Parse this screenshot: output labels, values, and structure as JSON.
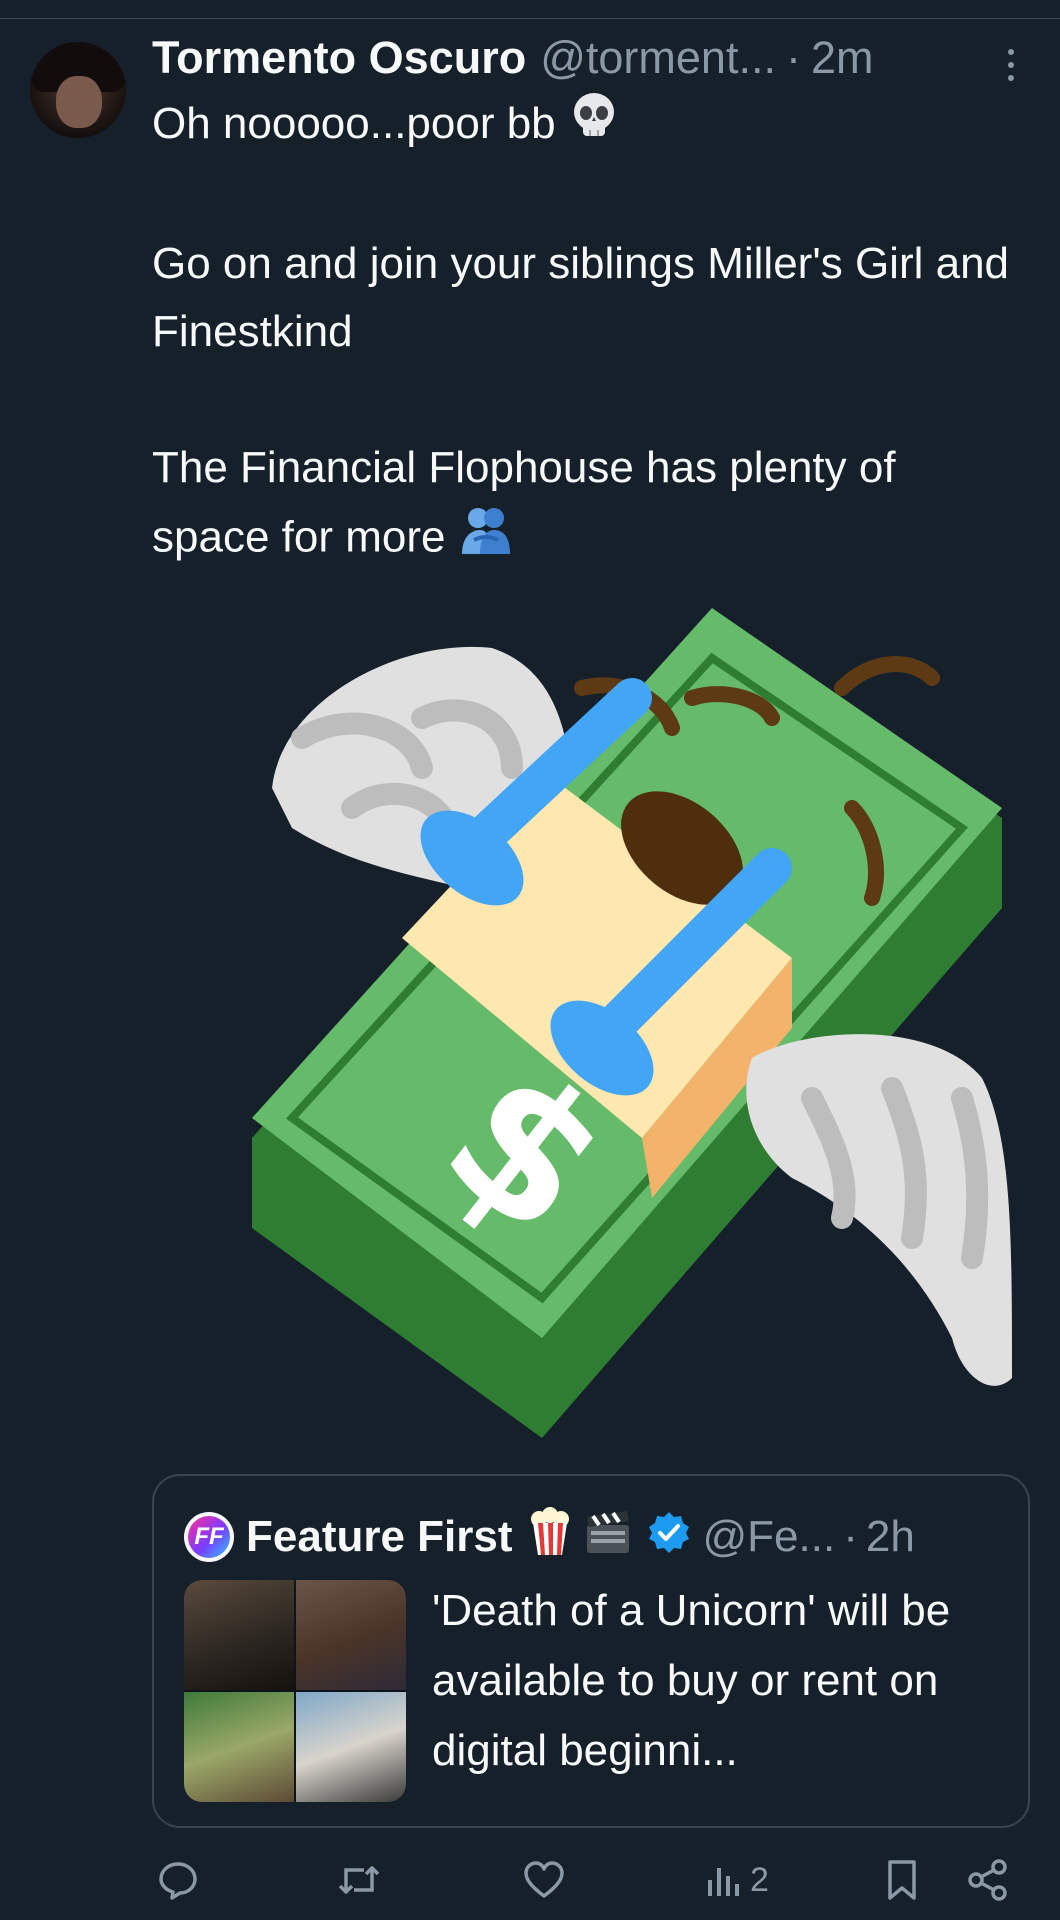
{
  "tweet": {
    "author_name": "Tormento Oscuro",
    "author_handle": "@torment...",
    "separator": "·",
    "time": "2m",
    "lines": [
      "Oh nooooo...poor bb",
      "Go on and join your siblings Miller's Girl and Finestkind",
      "The Financial Flophouse has plenty of space for more"
    ],
    "emoji_1": "skull-emoji",
    "emoji_2": "people-hugging-emoji",
    "media": "money-with-wings-emoji"
  },
  "quote": {
    "author_name": "Feature First",
    "author_handle": "@Fe...",
    "separator": "·",
    "time": "2h",
    "logo_letter": "FF",
    "text": "'Death of a Unicorn' will be available to buy or rent on digital beginni...",
    "verified": true
  },
  "actions": {
    "views": "2"
  },
  "colors": {
    "background": "#15202b",
    "text": "#f7f9f9",
    "secondary": "#8b98a5",
    "border": "#38444d",
    "verified": "#1d9bf0"
  }
}
